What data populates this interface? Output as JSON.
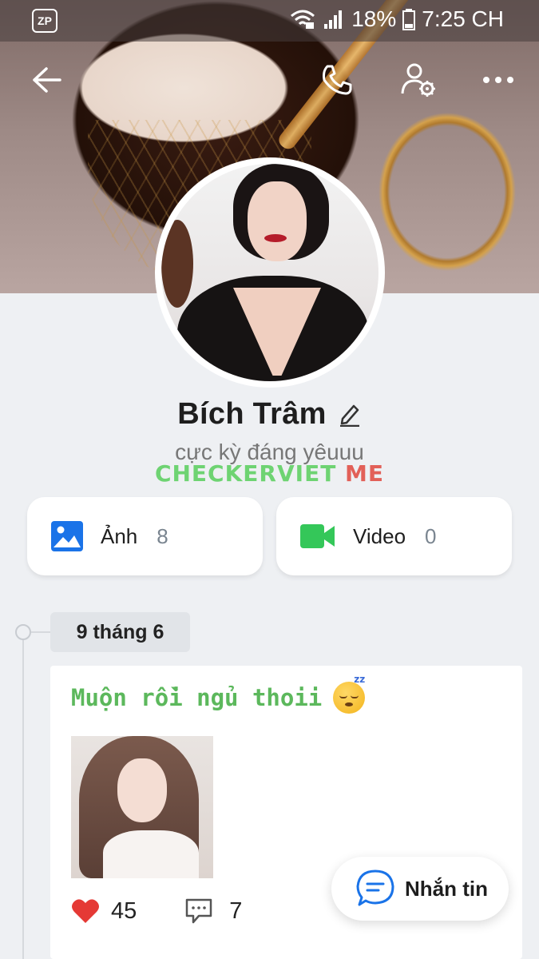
{
  "status_bar": {
    "app_badge": "ZP",
    "battery": "18%",
    "time": "7:25 CH"
  },
  "profile": {
    "name": "Bích Trâm",
    "status": "cực kỳ đáng yêuuu"
  },
  "watermark": {
    "main": "CHECKERVIET",
    "suffix": "ME"
  },
  "media": {
    "photos": {
      "label": "Ảnh",
      "count": "8"
    },
    "videos": {
      "label": "Video",
      "count": "0"
    }
  },
  "timeline": {
    "date": "9 tháng 6",
    "post": {
      "text": "Muộn rồi ngủ thoii",
      "likes": "45",
      "comments": "7"
    }
  },
  "message_button": {
    "label": "Nhắn tin"
  },
  "colors": {
    "accent_blue": "#1a73e8",
    "video_green": "#34c759",
    "post_text_green": "#5cb85c",
    "heart_red": "#e53935"
  },
  "icons": [
    "back-arrow-icon",
    "phone-icon",
    "user-settings-icon",
    "more-icon",
    "edit-icon",
    "image-icon",
    "video-icon",
    "heart-icon",
    "comment-icon",
    "chat-icon"
  ]
}
